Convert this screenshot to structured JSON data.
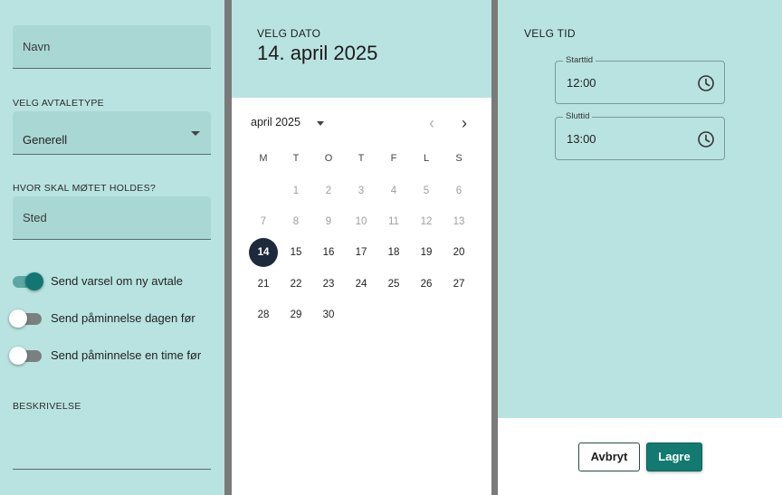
{
  "form": {
    "name_placeholder": "Navn",
    "type_label": "VELG AVTALETYPE",
    "type_value": "Generell",
    "location_label": "HVOR SKAL MØTET HOLDES?",
    "location_placeholder": "Sted",
    "switches": [
      {
        "label": "Send varsel om ny avtale",
        "on": true
      },
      {
        "label": "Send påminnelse dagen før",
        "on": false
      },
      {
        "label": "Send påminnelse en time før",
        "on": false
      }
    ],
    "description_label": "BESKRIVELSE"
  },
  "calendar": {
    "header_label": "VELG DATO",
    "selected_date_text": "14. april 2025",
    "month_label": "april 2025",
    "weekdays": [
      "M",
      "T",
      "O",
      "T",
      "F",
      "L",
      "S"
    ],
    "days": [
      "1",
      "2",
      "3",
      "4",
      "5",
      "6",
      "7",
      "8",
      "9",
      "10",
      "11",
      "12",
      "13",
      "14",
      "15",
      "16",
      "17",
      "18",
      "19",
      "20",
      "21",
      "22",
      "23",
      "24",
      "25",
      "26",
      "27",
      "28",
      "29",
      "30"
    ],
    "first_weekday_index": 1,
    "selected_day": "14",
    "min_enabled_day": 14,
    "prev_icon": "chevron-left-icon",
    "next_icon": "chevron-right-icon"
  },
  "time": {
    "title": "VELG TID",
    "start_label": "Starttid",
    "start_value": "12:00",
    "end_label": "Sluttid",
    "end_value": "13:00",
    "clock_icon": "clock-icon"
  },
  "actions": {
    "cancel_label": "Avbryt",
    "save_label": "Lagre"
  },
  "colors": {
    "panel_bg": "#b9e3e1",
    "field_bg": "#a9d7d4",
    "accent": "#137a72",
    "selected_day_bg": "#1c2a3c"
  }
}
